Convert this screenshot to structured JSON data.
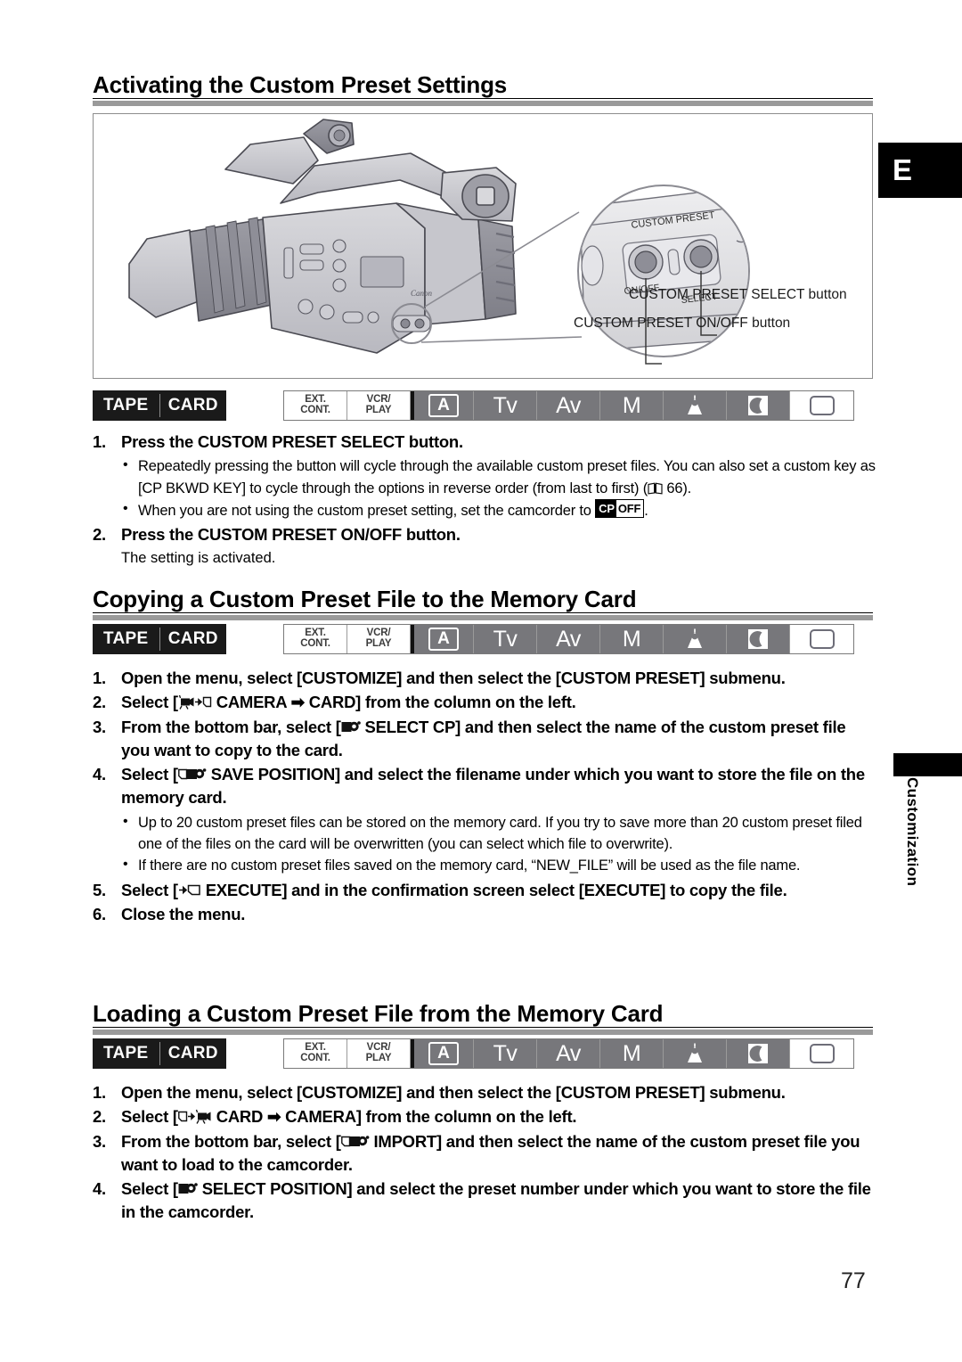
{
  "page": {
    "number": "77",
    "language_tab": "E",
    "section_tab": "Customization"
  },
  "sections": [
    {
      "id": "activating",
      "heading": "Activating the Custom Preset Settings",
      "figure": {
        "callouts": [
          {
            "name": "select-button",
            "label": "CUSTOM PRESET SELECT button"
          },
          {
            "name": "onoff-button",
            "label": "CUSTOM PRESET ON/OFF button"
          }
        ],
        "device_labels": {
          "panel_title": "CUSTOM PRESET",
          "left_button": "ON/OFF",
          "right_button": "SELECT",
          "brand": "Canon"
        }
      },
      "media_bar": {
        "tape": "TAPE",
        "card": "CARD"
      },
      "mode_bar": [
        {
          "name": "ext-cont",
          "line1": "EXT.",
          "line2": "CONT.",
          "state": "white"
        },
        {
          "name": "vcr-play",
          "line1": "VCR/",
          "line2": "PLAY",
          "state": "white"
        },
        {
          "name": "auto",
          "label": "A",
          "state": "gray"
        },
        {
          "name": "tv",
          "label": "Tv",
          "state": "gray"
        },
        {
          "name": "av",
          "label": "Av",
          "state": "gray"
        },
        {
          "name": "manual",
          "label": "M",
          "state": "gray"
        },
        {
          "name": "spotlight",
          "label": "",
          "state": "gray"
        },
        {
          "name": "night",
          "label": "",
          "state": "gray"
        },
        {
          "name": "easy",
          "label": "",
          "state": "white"
        }
      ],
      "steps": [
        {
          "num": "1.",
          "text": "Press the CUSTOM PRESET SELECT button.",
          "bullets": [
            "Repeatedly pressing the button will cycle through the available custom preset files. You can also set a custom key as [CP BKWD KEY] to cycle through the options in reverse order (from last to first) (",
            "When you are not using the custom preset setting, set the camcorder to "
          ],
          "bullet_tail_1": "66).",
          "bullet_tail_2": "."
        },
        {
          "num": "2.",
          "text": "Press the CUSTOM PRESET ON/OFF button.",
          "note": "The setting is activated."
        }
      ]
    },
    {
      "id": "copying",
      "heading": "Copying a Custom Preset File to the Memory Card",
      "media_bar": {
        "tape": "TAPE",
        "card": "CARD"
      },
      "steps": [
        {
          "num": "1.",
          "text": "Open the menu, select [CUSTOMIZE] and then select the [CUSTOM PRESET] submenu."
        },
        {
          "num": "2.",
          "pre": "Select [",
          "icon": "camera-to-card",
          "post": " CAMERA  ➡  CARD] from the column on the left."
        },
        {
          "num": "3.",
          "pre": "From the bottom bar, select [",
          "icon": "select-cp",
          "post": " SELECT CP] and then select the name of the custom preset file you want to copy to the card."
        },
        {
          "num": "4.",
          "pre": "Select [",
          "icon": "save-position",
          "post": " SAVE POSITION] and select the filename under which you want to store the file on the memory card."
        }
      ],
      "bullets": [
        "Up to 20 custom preset files can be stored on the memory card. If you try to save more than 20 custom preset filed one of the files on the card will be overwritten (you can select which file to overwrite).",
        "If there are no custom preset files saved on the memory card, “NEW_FILE” will be used as the file name."
      ],
      "steps_tail": [
        {
          "num": "5.",
          "pre": "Select [",
          "icon": "execute-card",
          "post": " EXECUTE] and in the confirmation screen select [EXECUTE] to copy the file."
        },
        {
          "num": "6.",
          "text": "Close the menu."
        }
      ]
    },
    {
      "id": "loading",
      "heading": "Loading a Custom Preset File from the Memory Card",
      "media_bar": {
        "tape": "TAPE",
        "card": "CARD"
      },
      "steps": [
        {
          "num": "1.",
          "text": "Open the menu, select [CUSTOMIZE] and then select the [CUSTOM PRESET] submenu."
        },
        {
          "num": "2.",
          "pre": "Select [",
          "icon": "card-to-camera",
          "post": " CARD  ➡  CAMERA] from the column on the left."
        },
        {
          "num": "3.",
          "pre": "From the bottom bar, select [",
          "icon": "import",
          "post": " IMPORT] and then select the name of the custom preset file you want to load to the camcorder."
        },
        {
          "num": "4.",
          "pre": "Select [",
          "icon": "select-position",
          "post": " SELECT POSITION] and select the preset number under which you want to store the file in the camcorder."
        }
      ]
    }
  ],
  "colors": {
    "rule": "#9a9a9a",
    "mode_active": "#77777b",
    "mode_inactive": "#ffffff",
    "media_bg": "#1a1a1a"
  }
}
